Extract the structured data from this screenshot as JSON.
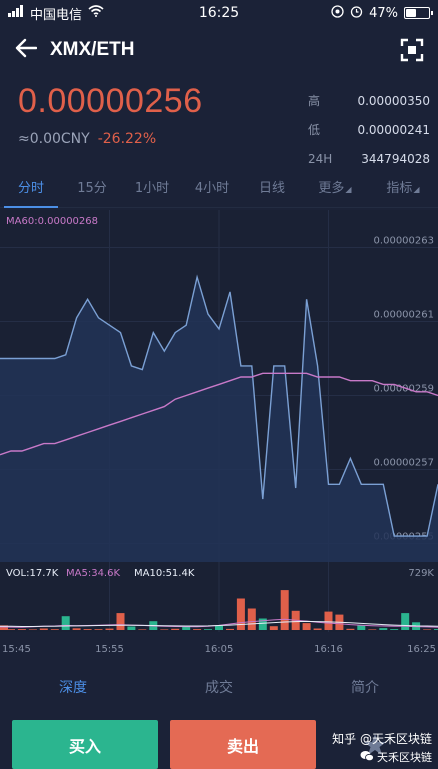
{
  "status_bar": {
    "carrier": "中国电信",
    "time": "16:25",
    "battery": "47%",
    "battery_level": 0.47
  },
  "header": {
    "title": "XMX/ETH",
    "back_icon": "arrow-left-icon",
    "scan_icon": "fullscreen-icon"
  },
  "price": {
    "last": "0.00000256",
    "cny": "≈0.00CNY",
    "change": "-26.22%",
    "up_color": "#2bb58f",
    "down_color": "#e0604a"
  },
  "stats": [
    {
      "label": "高",
      "value": "0.00000350"
    },
    {
      "label": "低",
      "value": "0.00000241"
    },
    {
      "label": "24H",
      "value": "344794028"
    }
  ],
  "tabs": [
    {
      "label": "分时",
      "active": true
    },
    {
      "label": "15分",
      "active": false
    },
    {
      "label": "1小时",
      "active": false
    },
    {
      "label": "4小时",
      "active": false
    },
    {
      "label": "日线",
      "active": false
    },
    {
      "label": "更多",
      "active": false
    },
    {
      "label": "指标",
      "active": false
    }
  ],
  "chart_data": {
    "type": "line",
    "ma_label": "MA60:0.00000268",
    "price_ticks": [
      "0.00000263",
      "0.00000261",
      "0.00000259",
      "0.00000257",
      "0.00000255"
    ],
    "yticks": [
      2.63e-06,
      2.61e-06,
      2.59e-06,
      2.57e-06,
      2.55e-06
    ],
    "ylim": [
      2.545e-06,
      2.6385e-06
    ],
    "x": [
      0,
      1,
      2,
      3,
      4,
      5,
      6,
      7,
      8,
      9,
      10,
      11,
      12,
      13,
      14,
      15,
      16,
      17,
      18,
      19,
      20,
      21,
      22,
      23,
      24,
      25,
      26,
      27,
      28,
      29,
      30,
      31,
      32,
      33,
      34,
      35,
      36,
      37,
      38,
      39,
      40
    ],
    "xlim": [
      0,
      40
    ],
    "series": [
      {
        "name": "price",
        "values": [
          2.6e-06,
          2.6e-06,
          2.6e-06,
          2.6e-06,
          2.6e-06,
          2.6e-06,
          2.601e-06,
          2.611e-06,
          2.616e-06,
          2.611e-06,
          2.609e-06,
          2.607e-06,
          2.598e-06,
          2.597e-06,
          2.607e-06,
          2.602e-06,
          2.607e-06,
          2.609e-06,
          2.622e-06,
          2.612e-06,
          2.608e-06,
          2.618e-06,
          2.598e-06,
          2.598e-06,
          2.562e-06,
          2.598e-06,
          2.598e-06,
          2.565e-06,
          2.616e-06,
          2.598e-06,
          2.566e-06,
          2.566e-06,
          2.573e-06,
          2.566e-06,
          2.566e-06,
          2.566e-06,
          2.552e-06,
          2.552e-06,
          2.552e-06,
          2.552e-06,
          2.566e-06
        ],
        "color": "#7ba0d4"
      },
      {
        "name": "MA60",
        "values": [
          2.574e-06,
          2.575e-06,
          2.575e-06,
          2.576e-06,
          2.577e-06,
          2.577e-06,
          2.578e-06,
          2.579e-06,
          2.58e-06,
          2.581e-06,
          2.582e-06,
          2.583e-06,
          2.584e-06,
          2.585e-06,
          2.586e-06,
          2.587e-06,
          2.589e-06,
          2.59e-06,
          2.591e-06,
          2.592e-06,
          2.593e-06,
          2.594e-06,
          2.595e-06,
          2.595e-06,
          2.596e-06,
          2.596e-06,
          2.596e-06,
          2.596e-06,
          2.596e-06,
          2.595e-06,
          2.595e-06,
          2.595e-06,
          2.594e-06,
          2.594e-06,
          2.594e-06,
          2.593e-06,
          2.593e-06,
          2.592e-06,
          2.591e-06,
          2.591e-06,
          2.59e-06
        ],
        "color": "#c879c8"
      }
    ],
    "volume": {
      "label_vol": "VOL:17.7K",
      "label_ma5": "MA5:34.6K",
      "label_ma10": "MA10:51.4K",
      "max_label": "729K",
      "max": 729,
      "values": [
        60,
        10,
        12,
        8,
        20,
        10,
        180,
        22,
        12,
        10,
        18,
        220,
        45,
        8,
        115,
        8,
        15,
        42,
        12,
        10,
        55,
        14,
        410,
        280,
        150,
        50,
        520,
        250,
        90,
        20,
        240,
        200,
        15,
        60,
        8,
        25,
        12,
        220,
        100,
        8,
        12
      ],
      "colors": [
        "down",
        "down",
        "down",
        "down",
        "down",
        "down",
        "up",
        "down",
        "down",
        "down",
        "down",
        "down",
        "up",
        "down",
        "up",
        "down",
        "down",
        "up",
        "down",
        "up",
        "up",
        "down",
        "down",
        "down",
        "up",
        "down",
        "down",
        "down",
        "down",
        "down",
        "down",
        "down",
        "down",
        "up",
        "down",
        "up",
        "up",
        "up",
        "up",
        "down",
        "up"
      ],
      "ma5": [
        40,
        38,
        36,
        42,
        48,
        52,
        60,
        55,
        58,
        62,
        66,
        70,
        64,
        60,
        52,
        48,
        46,
        44,
        42,
        48,
        60,
        78,
        96,
        110,
        120,
        132,
        140,
        128,
        116,
        100,
        90,
        82,
        70,
        62,
        56,
        52,
        50,
        48,
        44,
        40,
        36
      ],
      "ma10": [
        50,
        48,
        46,
        46,
        48,
        50,
        52,
        54,
        56,
        58,
        60,
        62,
        62,
        60,
        58,
        56,
        54,
        52,
        52,
        54,
        58,
        64,
        72,
        80,
        88,
        96,
        104,
        110,
        112,
        110,
        106,
        100,
        94,
        86,
        78,
        70,
        64,
        58,
        54,
        52,
        50
      ],
      "ma5_color": "#c879c8",
      "ma10_color": "#e8eef8"
    },
    "time_labels": [
      "15:45",
      "15:55",
      "16:05",
      "16:16",
      "16:25"
    ],
    "grid": true
  },
  "bottom_tabs": [
    {
      "label": "深度",
      "active": true
    },
    {
      "label": "成交",
      "active": false
    },
    {
      "label": "简介",
      "active": false
    }
  ],
  "actions": {
    "buy": "买入",
    "sell": "卖出",
    "fav_icon": "star-icon"
  },
  "watermark": {
    "line1": "知乎 @天禾区块链",
    "line2": "天禾区块链"
  }
}
